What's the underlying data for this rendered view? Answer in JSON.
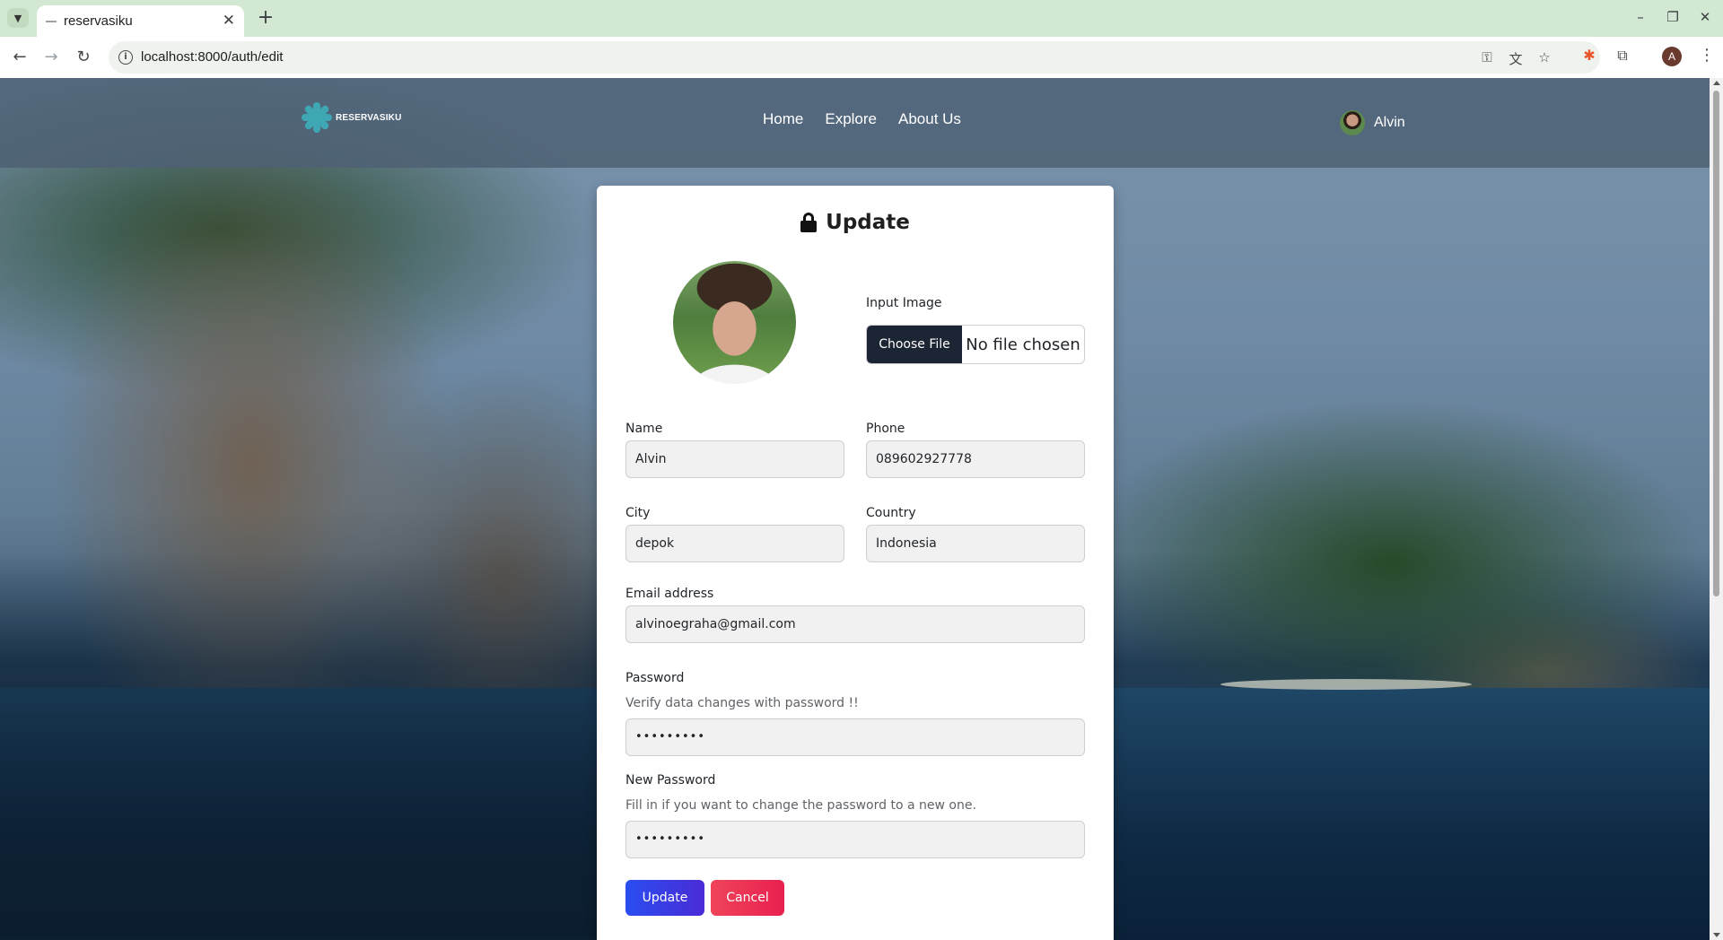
{
  "browser": {
    "tab_title": "reservasiku",
    "url": "localhost:8000/auth/edit",
    "profile_initial": "A"
  },
  "site": {
    "logo_text": "RESERVASIKU",
    "nav": [
      "Home",
      "Explore",
      "About Us"
    ],
    "user_name": "Alvin"
  },
  "form": {
    "title": "Update",
    "image": {
      "label": "Input Image",
      "button": "Choose File",
      "status": "No file chosen"
    },
    "name": {
      "label": "Name",
      "value": "Alvin"
    },
    "phone": {
      "label": "Phone",
      "value": "089602927778"
    },
    "city": {
      "label": "City",
      "value": "depok"
    },
    "country": {
      "label": "Country",
      "value": "Indonesia"
    },
    "email": {
      "label": "Email address",
      "value": "alvinoegraha@gmail.com"
    },
    "password": {
      "label": "Password",
      "help": "Verify data changes with password !!",
      "value": "•••••••••"
    },
    "new_password": {
      "label": "New Password",
      "help": "Fill in if you want to change the password to a new one.",
      "value": "•••••••••"
    },
    "update_button": "Update",
    "cancel_button": "Cancel"
  }
}
